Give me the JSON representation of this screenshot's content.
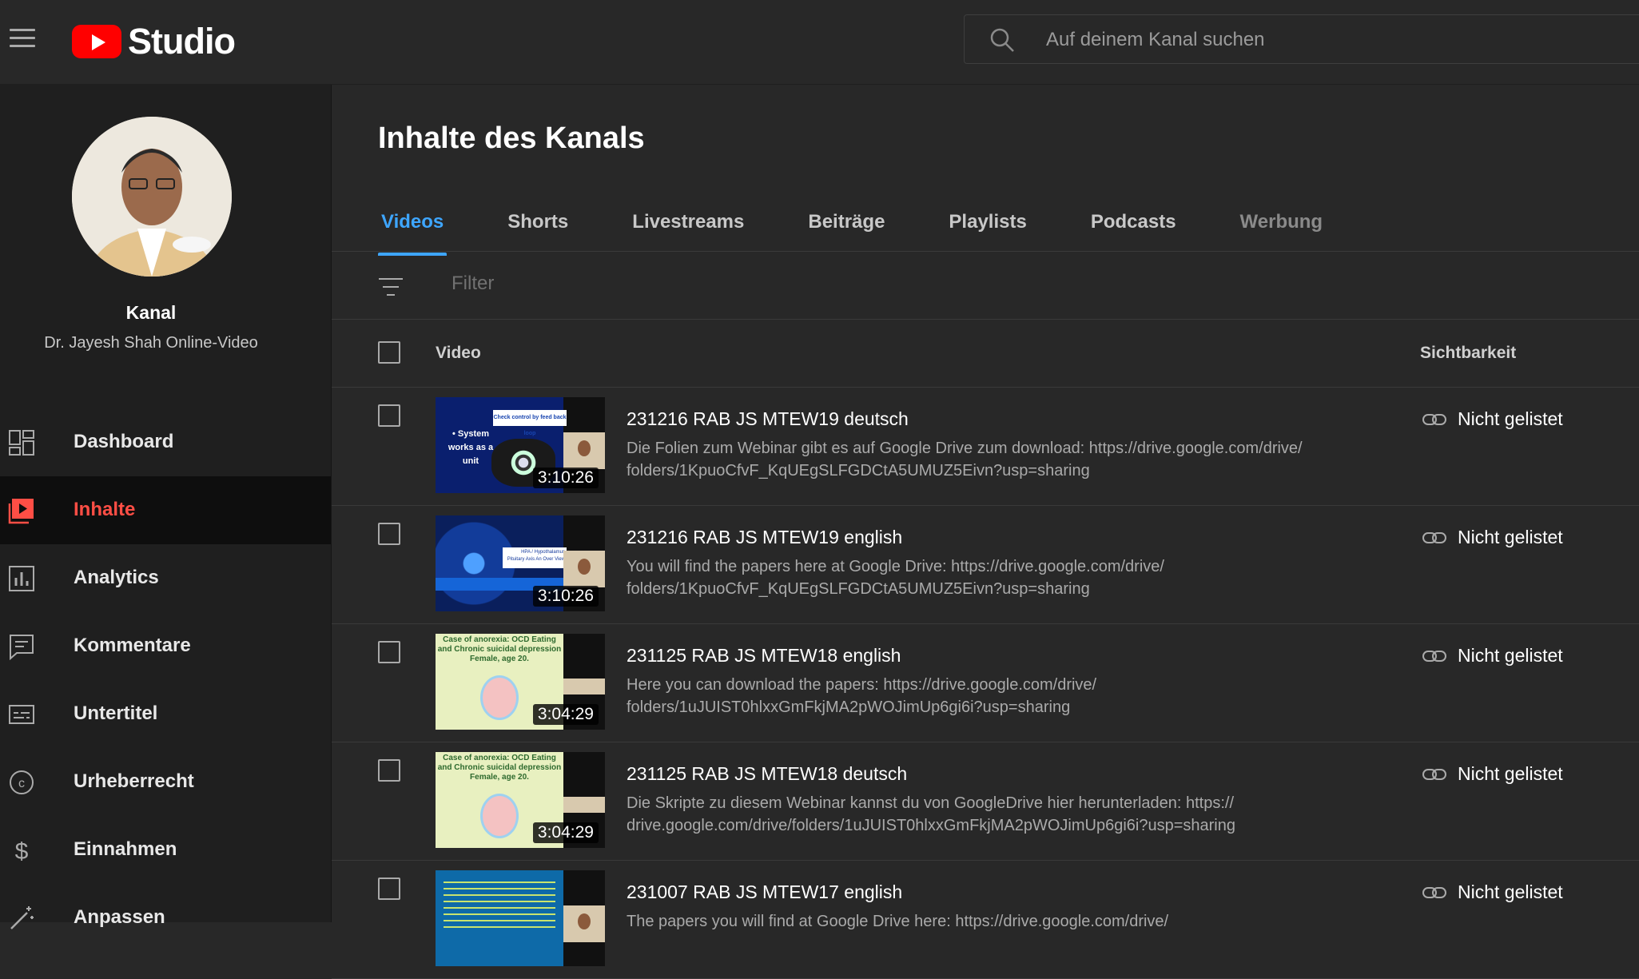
{
  "header": {
    "app_name": "Studio",
    "search_placeholder": "Auf deinem Kanal suchen"
  },
  "sidebar": {
    "channel_title": "Kanal",
    "channel_name": "Dr. Jayesh Shah Online-Video",
    "items": [
      {
        "label": "Dashboard",
        "icon": "dashboard-icon"
      },
      {
        "label": "Inhalte",
        "icon": "content-icon",
        "active": true
      },
      {
        "label": "Analytics",
        "icon": "analytics-icon"
      },
      {
        "label": "Kommentare",
        "icon": "comments-icon"
      },
      {
        "label": "Untertitel",
        "icon": "subtitles-icon"
      },
      {
        "label": "Urheberrecht",
        "icon": "copyright-icon"
      },
      {
        "label": "Einnahmen",
        "icon": "dollar-icon"
      },
      {
        "label": "Anpassen",
        "icon": "magic-wand-icon"
      }
    ]
  },
  "main": {
    "title": "Inhalte des Kanals",
    "tabs": [
      {
        "label": "Videos"
      },
      {
        "label": "Shorts"
      },
      {
        "label": "Livestreams"
      },
      {
        "label": "Beiträge"
      },
      {
        "label": "Playlists"
      },
      {
        "label": "Podcasts"
      },
      {
        "label": "Werbung"
      }
    ],
    "filter_placeholder": "Filter",
    "columns": {
      "video": "Video",
      "visibility": "Sichtbarkeit"
    },
    "videos": [
      {
        "title": "231216 RAB JS MTEW19 deutsch",
        "desc_line1": "Die Folien zum Webinar gibt es auf Google Drive zum download: https://drive.google.com/drive/",
        "desc_line2": "folders/1KpuoCfvF_KqUEgSLFGDCtA5UMUZ5Eivn?usp=sharing",
        "duration": "3:10:26",
        "visibility": "Nicht gelistet",
        "thumb_text": "• System works as a unit",
        "thumb_banner": "Check control by feed back loop"
      },
      {
        "title": "231216 RAB JS MTEW19 english",
        "desc_line1": "You will find the papers here at Google Drive: https://drive.google.com/drive/",
        "desc_line2": "folders/1KpuoCfvF_KqUEgSLFGDCtA5UMUZ5Eivn?usp=sharing",
        "duration": "3:10:26",
        "visibility": "Nicht gelistet",
        "thumb_text": "HPA / Hypothalamus Pituitary Axis An Over View"
      },
      {
        "title": "231125 RAB JS MTEW18 english",
        "desc_line1": "Here you can download the papers: https://drive.google.com/drive/",
        "desc_line2": "folders/1uJUIST0hlxxGmFkjMA2pWOJimUp6gi6i?usp=sharing",
        "duration": "3:04:29",
        "visibility": "Nicht gelistet",
        "thumb_text": "Case of anorexia: OCD Eating and Chronic suicidal depression Female, age 20."
      },
      {
        "title": "231125 RAB JS MTEW18 deutsch",
        "desc_line1": "Die Skripte zu diesem Webinar kannst du von GoogleDrive hier herunterladen: https://",
        "desc_line2": "drive.google.com/drive/folders/1uJUIST0hlxxGmFkjMA2pWOJimUp6gi6i?usp=sharing",
        "duration": "3:04:29",
        "visibility": "Nicht gelistet",
        "thumb_text": "Case of anorexia: OCD Eating and Chronic suicidal depression Female, age 20."
      },
      {
        "title": "231007 RAB JS MTEW17 english",
        "desc_line1": "The papers you will find at Google Drive here: https://drive.google.com/drive/",
        "desc_line2": "",
        "duration": "",
        "visibility": "Nicht gelistet"
      }
    ]
  },
  "colors": {
    "accent": "#3ea6ff",
    "active_nav": "#ff4e45",
    "brand_red": "#ff0000",
    "background": "#282828",
    "sidebar": "#1f1f1f"
  }
}
